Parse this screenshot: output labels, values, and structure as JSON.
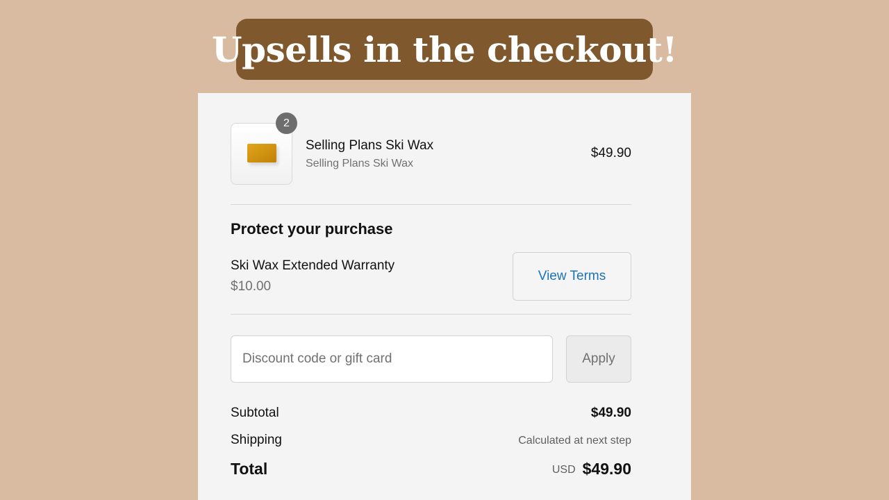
{
  "banner": {
    "title": "Upsells in the checkout!"
  },
  "line_item": {
    "quantity": "2",
    "title": "Selling Plans Ski Wax",
    "subtitle": "Selling Plans Ski Wax",
    "price": "$49.90",
    "thumbnail_color": "#d9990f"
  },
  "protection": {
    "heading": "Protect your purchase",
    "product_name": "Ski Wax Extended Warranty",
    "price": "$10.00",
    "terms_button": "View Terms"
  },
  "discount": {
    "placeholder": "Discount code or gift card",
    "value": "",
    "apply_button": "Apply"
  },
  "summary": {
    "subtotal_label": "Subtotal",
    "subtotal_value": "$49.90",
    "shipping_label": "Shipping",
    "shipping_value": "Calculated at next step",
    "total_label": "Total",
    "currency": "USD",
    "total_value": "$49.90"
  },
  "colors": {
    "page_background": "#d8bba0",
    "banner_background": "#80582e",
    "link_blue": "#1a73b8",
    "panel_background": "#f4f4f4"
  }
}
